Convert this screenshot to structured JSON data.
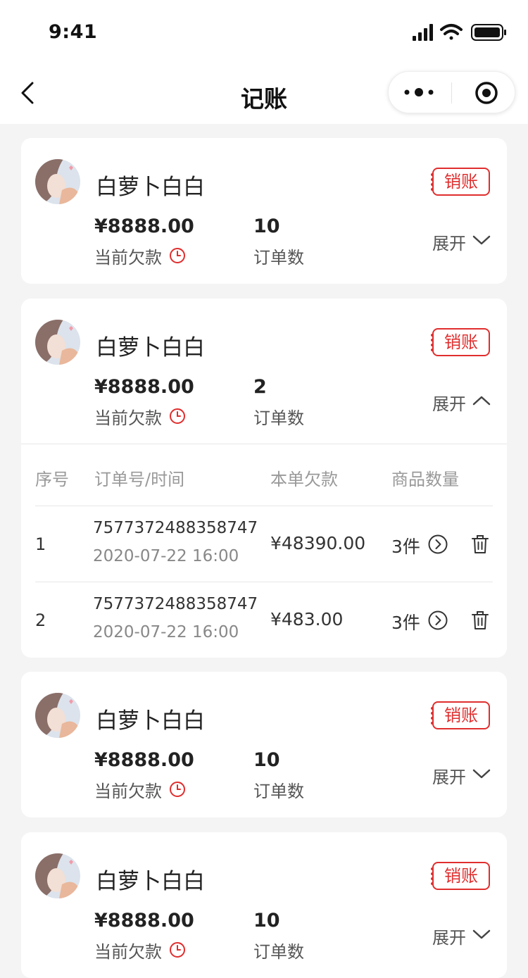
{
  "status_bar": {
    "time": "9:41"
  },
  "nav": {
    "title": "记账"
  },
  "cards": [
    {
      "name": "白萝卜白白",
      "settle_label": "销账",
      "amount": "¥8888.00",
      "debt_label": "当前欠款",
      "order_count": "10",
      "count_label": "订单数",
      "toggle_label": "展开",
      "expanded": false
    },
    {
      "name": "白萝卜白白",
      "settle_label": "销账",
      "amount": "¥8888.00",
      "debt_label": "当前欠款",
      "order_count": "2",
      "count_label": "订单数",
      "toggle_label": "展开",
      "expanded": true,
      "table": {
        "headers": [
          "序号",
          "订单号/时间",
          "本单欠款",
          "商品数量"
        ],
        "rows": [
          {
            "index": "1",
            "order_no": "7577372488358747",
            "time": "2020-07-22 16:00",
            "debt": "¥48390.00",
            "qty": "3件"
          },
          {
            "index": "2",
            "order_no": "7577372488358747",
            "time": "2020-07-22 16:00",
            "debt": "¥483.00",
            "qty": "3件"
          }
        ]
      }
    },
    {
      "name": "白萝卜白白",
      "settle_label": "销账",
      "amount": "¥8888.00",
      "debt_label": "当前欠款",
      "order_count": "10",
      "count_label": "订单数",
      "toggle_label": "展开",
      "expanded": false
    },
    {
      "name": "白萝卜白白",
      "settle_label": "销账",
      "amount": "¥8888.00",
      "debt_label": "当前欠款",
      "order_count": "10",
      "count_label": "订单数",
      "toggle_label": "展开",
      "expanded": false
    }
  ],
  "colors": {
    "accent": "#e02e2e",
    "background": "#f4f4f4",
    "card": "#ffffff"
  },
  "icons": [
    "back-arrow-icon",
    "more-dots-icon",
    "close-target-icon",
    "clock-icon",
    "chevron-down-icon",
    "chevron-up-icon",
    "arrow-right-circle-icon",
    "trash-icon",
    "signal-icon",
    "wifi-icon",
    "battery-icon"
  ]
}
